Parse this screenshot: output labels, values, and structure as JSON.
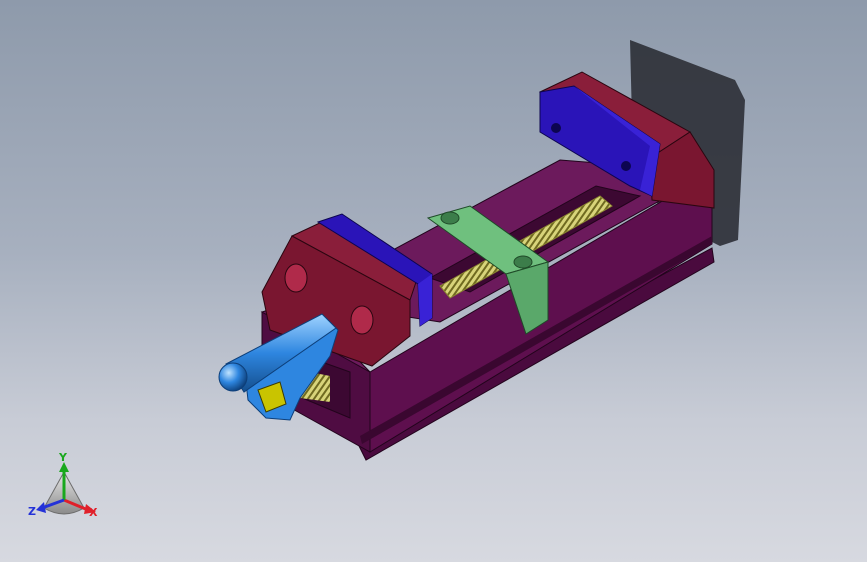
{
  "viewport": {
    "background_top": "#8e9aab",
    "background_bottom": "#d7d9e0"
  },
  "model": {
    "colors": {
      "body": "#5e0f4e",
      "fixed_jaw": "#7a1630",
      "jaw_plate": "#2a14b8",
      "slide_block": "#5fb070",
      "screw": "#d8d47a",
      "handle": "#2e86e0",
      "handle_square": "#c9c400",
      "shadow": "#2c2f36"
    }
  },
  "triad": {
    "x_label": "X",
    "y_label": "Y",
    "z_label": "Z",
    "x_color": "#e0202a",
    "y_color": "#19a81d",
    "z_color": "#2432d8"
  }
}
